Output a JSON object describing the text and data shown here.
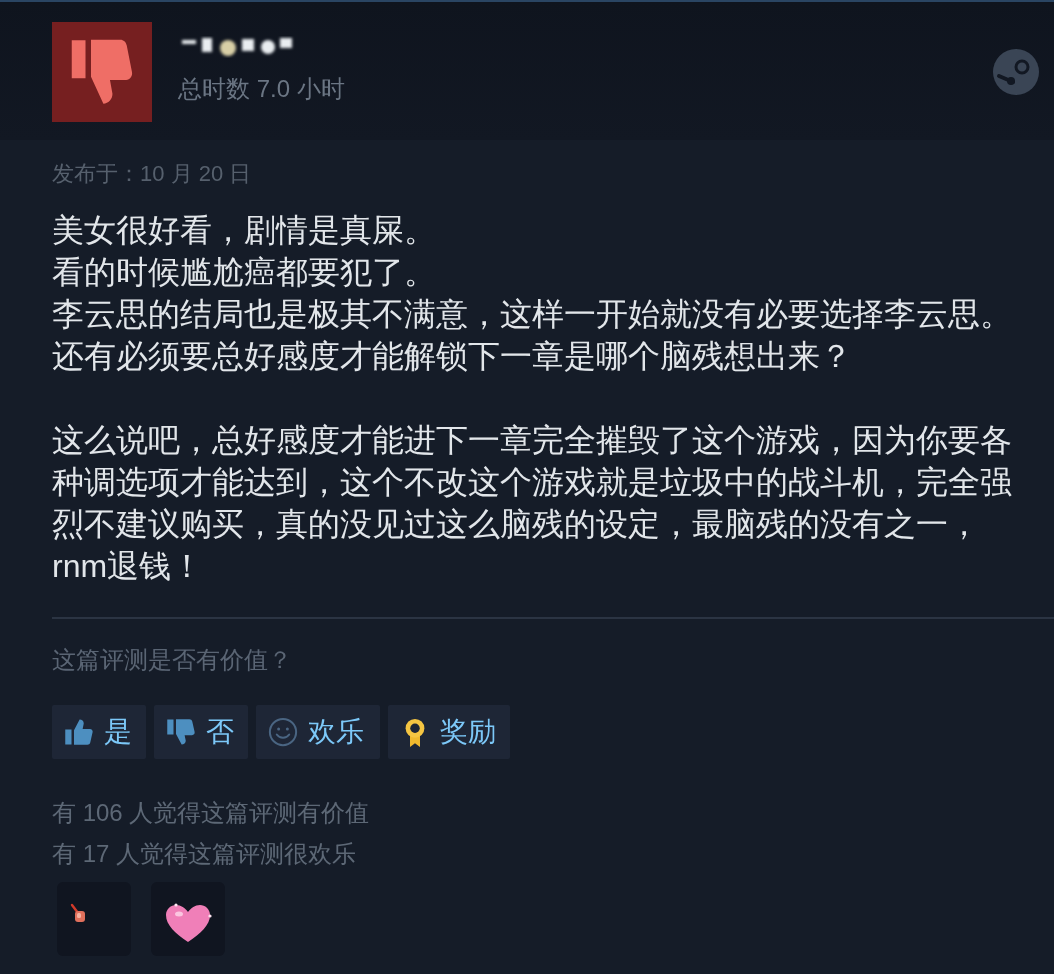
{
  "review": {
    "recommended": false,
    "playtime": "总时数 7.0 小时",
    "posted": "发布于：10 月 20 日",
    "paragraphs": [
      {
        "lines": [
          "美女很好看，剧情是真屎。",
          "看的时候尴尬癌都要犯了。",
          "李云思的结局也是极其不满意，这样一开始就没有必要选择李云思。",
          "还有必须要总好感度才能解锁下一章是哪个脑残想出来？"
        ]
      },
      {
        "lines": [
          "这么说吧，总好感度才能进下一章完全摧毁了这个游戏，因为你要各种调选项才能达到，这个不改这个游戏就是垃圾中的战斗机，完全强烈不建议购买，真的没见过这么脑残的设定，最脑残的没有之一，rnm退钱！"
        ]
      }
    ]
  },
  "feedback": {
    "prompt": "这篇评测是否有价值？",
    "buttons": [
      {
        "kind": "yes",
        "label": "是"
      },
      {
        "kind": "no",
        "label": "否"
      },
      {
        "kind": "funny",
        "label": "欢乐"
      },
      {
        "kind": "award",
        "label": "奖励"
      }
    ]
  },
  "tallies": [
    "有 106 人觉得这篇评测有价值",
    "有 17 人觉得这篇评测很欢乐"
  ],
  "awards": [
    {
      "kind": "candle"
    },
    {
      "kind": "heart"
    }
  ]
}
